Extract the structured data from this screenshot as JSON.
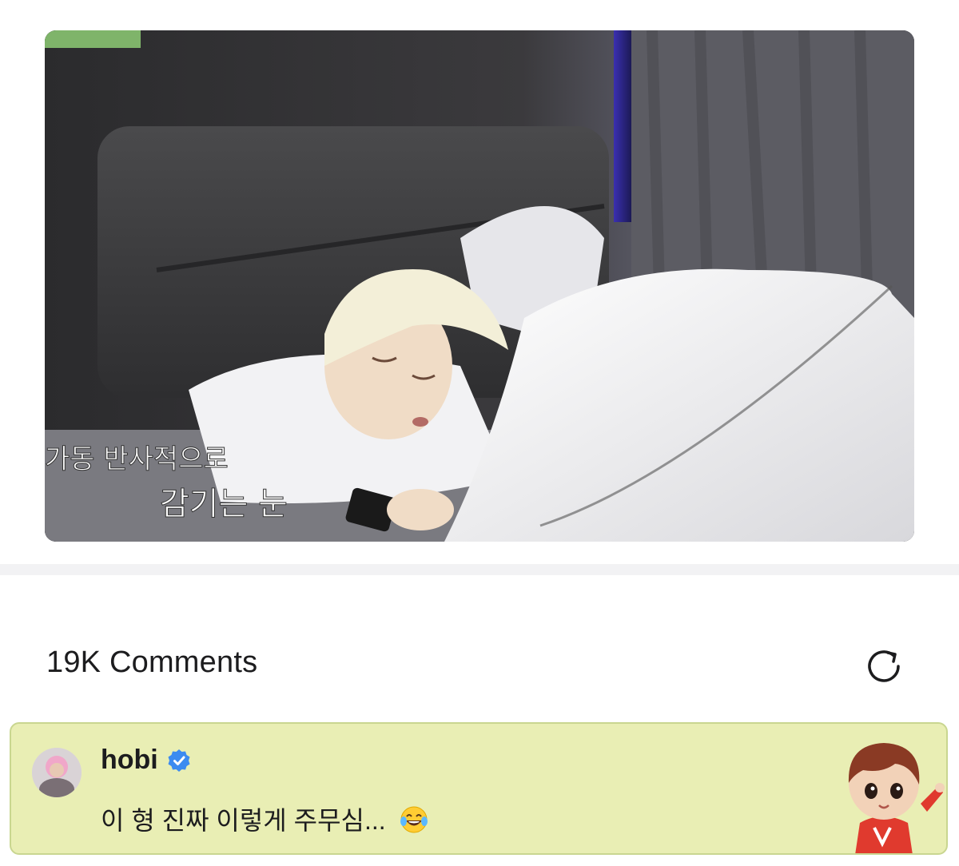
{
  "media": {
    "caption_line1": "가동 반사적으로",
    "caption_line2": "감기는 눈",
    "icon": "photo-sleeping-in-bed"
  },
  "comments": {
    "header": "19K Comments",
    "refresh_icon": "refresh-icon"
  },
  "comment": {
    "author": "hobi",
    "verified_icon": "verified-badge-icon",
    "text": "이 형 진짜 이렇게 주무심...",
    "emoji_icon": "laughing-tears-emoji-icon",
    "sticker_icon": "character-sticker-icon",
    "bg_color": "#e9eeb4",
    "verified_color": "#3c8bf0"
  }
}
